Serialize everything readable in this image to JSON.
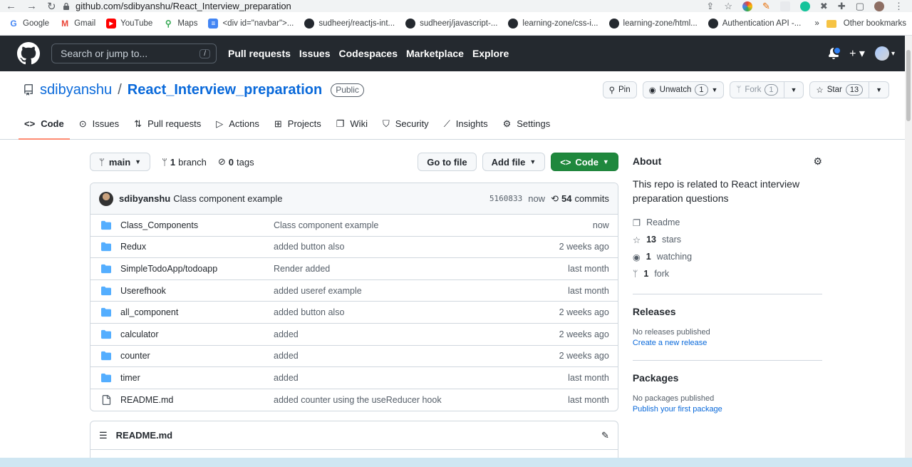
{
  "browser": {
    "url": "github.com/sdibyanshu/React_Interview_preparation",
    "bookmarks": [
      "Google",
      "Gmail",
      "YouTube",
      "Maps",
      "<div id=\"navbar\">...",
      "sudheerj/reactjs-int...",
      "sudheerj/javascript-...",
      "learning-zone/css-i...",
      "learning-zone/html...",
      "Authentication API -..."
    ],
    "overflow": "»",
    "other_bookmarks": "Other bookmarks"
  },
  "header": {
    "search_placeholder": "Search or jump to...",
    "search_key": "/",
    "nav": [
      "Pull requests",
      "Issues",
      "Codespaces",
      "Marketplace",
      "Explore"
    ]
  },
  "repo": {
    "owner": "sdibyanshu",
    "separator": "/",
    "name": "React_Interview_preparation",
    "visibility": "Public",
    "pin_label": "Pin",
    "watch_label": "Unwatch",
    "watch_count": "1",
    "fork_label": "Fork",
    "fork_count": "1",
    "star_label": "Star",
    "star_count": "13"
  },
  "tabs": [
    "Code",
    "Issues",
    "Pull requests",
    "Actions",
    "Projects",
    "Wiki",
    "Security",
    "Insights",
    "Settings"
  ],
  "file_nav": {
    "branch": "main",
    "branch_count": "1",
    "branch_word": "branch",
    "tag_count": "0",
    "tag_word": "tags",
    "go_to_file": "Go to file",
    "add_file": "Add file",
    "code": "Code"
  },
  "latest_commit": {
    "author": "sdibyanshu",
    "message": "Class component example",
    "sha": "5160833",
    "time": "now",
    "commit_count": "54",
    "commit_word": "commits"
  },
  "files": [
    {
      "type": "folder",
      "name": "Class_Components",
      "message": "Class component example",
      "age": "now"
    },
    {
      "type": "folder",
      "name": "Redux",
      "message": "added button also",
      "age": "2 weeks ago"
    },
    {
      "type": "folder",
      "name": "SimpleTodoApp/todoapp",
      "message": "Render added",
      "age": "last month"
    },
    {
      "type": "folder",
      "name": "Userefhook",
      "message": "added useref example",
      "age": "last month"
    },
    {
      "type": "folder",
      "name": "all_component",
      "message": "added button also",
      "age": "2 weeks ago"
    },
    {
      "type": "folder",
      "name": "calculator",
      "message": "added",
      "age": "2 weeks ago"
    },
    {
      "type": "folder",
      "name": "counter",
      "message": "added",
      "age": "2 weeks ago"
    },
    {
      "type": "folder",
      "name": "timer",
      "message": "added",
      "age": "last month"
    },
    {
      "type": "file",
      "name": "README.md",
      "message": "added counter using the useReducer hook",
      "age": "last month"
    }
  ],
  "readme": {
    "title": "README.md"
  },
  "about": {
    "title": "About",
    "description": "This repo is related to React interview preparation questions",
    "readme": "Readme",
    "stars_count": "13",
    "stars_word": "stars",
    "watching_count": "1",
    "watching_word": "watching",
    "fork_count": "1",
    "fork_word": "fork"
  },
  "releases": {
    "title": "Releases",
    "empty": "No releases published",
    "create": "Create a new release"
  },
  "packages": {
    "title": "Packages",
    "empty": "No packages published",
    "publish": "Publish your first package"
  },
  "colors": {
    "header_bg": "#24292f",
    "link": "#0969da",
    "folder": "#54aeff",
    "code_button": "#1f883d",
    "active_tab": "#fd8c73"
  }
}
